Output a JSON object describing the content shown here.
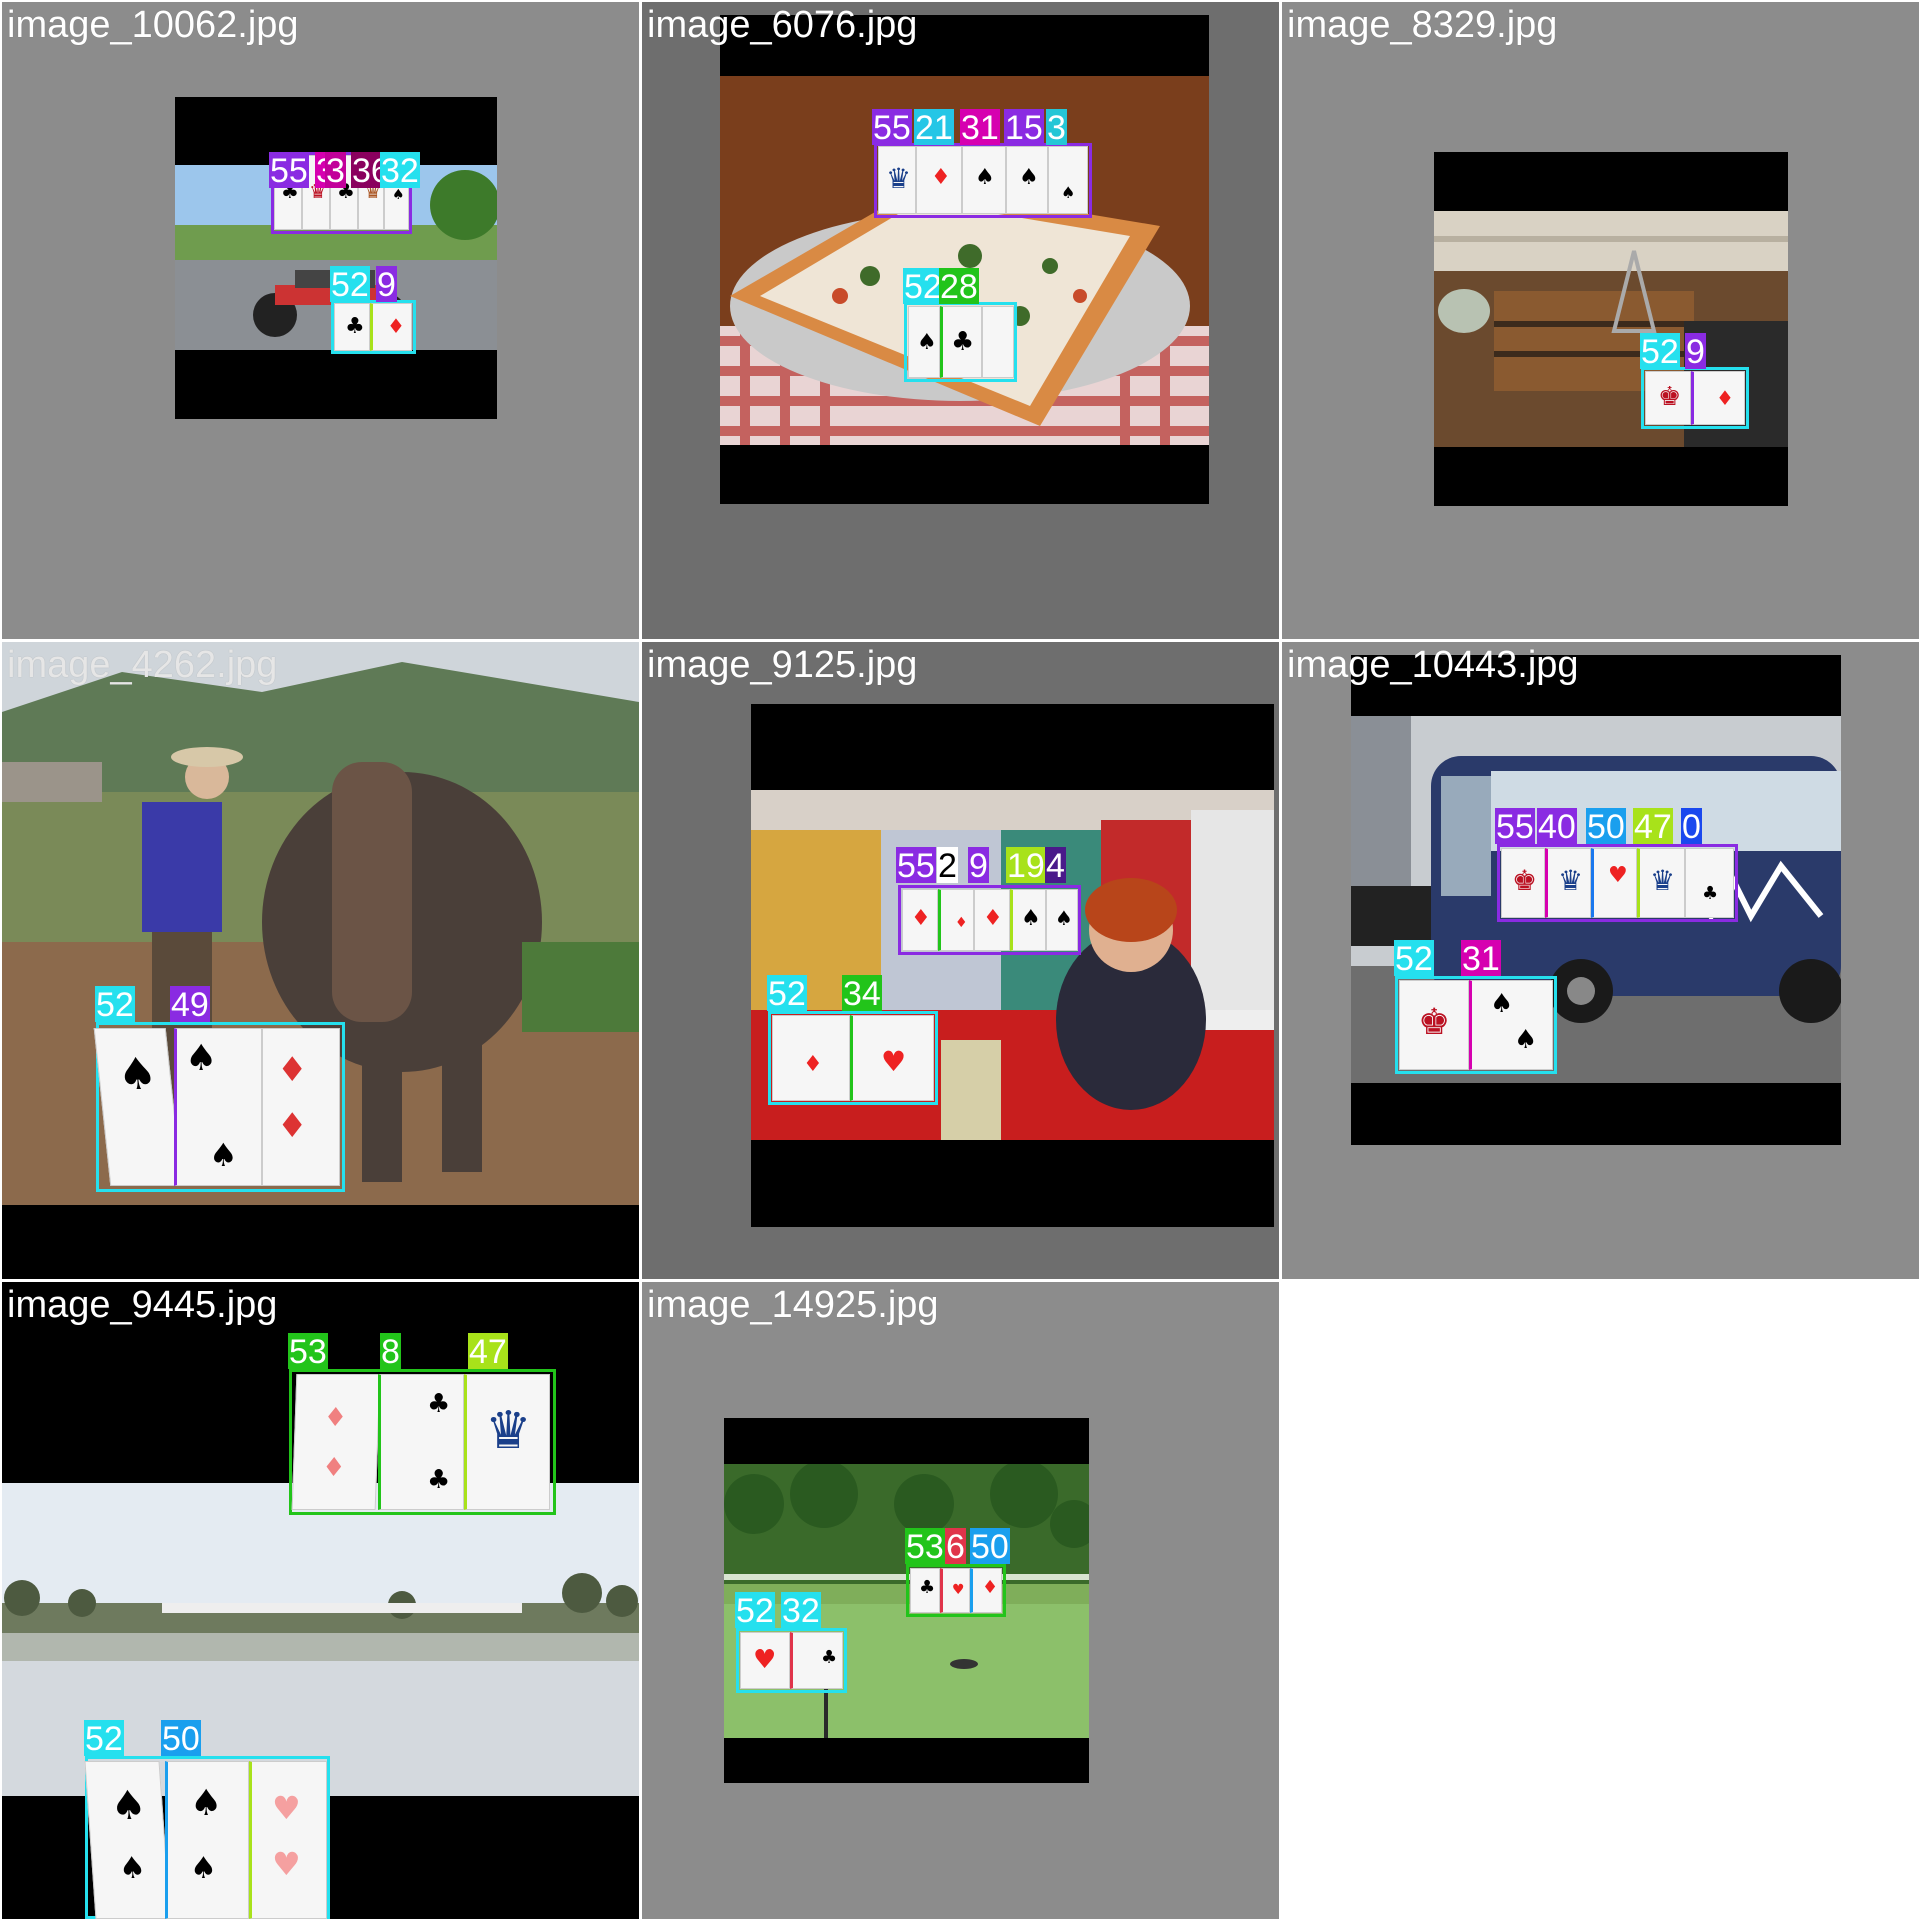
{
  "tiles": [
    {
      "file": "image_10062.jpg",
      "labels": [
        "55",
        "3",
        "3",
        "36",
        "32",
        "52",
        "9"
      ]
    },
    {
      "file": "image_6076.jpg",
      "labels": [
        "55",
        "21",
        "31",
        "15",
        "3",
        "52",
        "28"
      ]
    },
    {
      "file": "image_8329.jpg",
      "labels": [
        "52",
        "9"
      ]
    },
    {
      "file": "image_4262.jpg",
      "labels": [
        "52",
        "49"
      ]
    },
    {
      "file": "image_9125.jpg",
      "labels": [
        "55",
        "2",
        "9",
        "19",
        "4",
        "52",
        "34"
      ]
    },
    {
      "file": "image_10443.jpg",
      "labels": [
        "55",
        "40",
        "50",
        "47",
        "0",
        "52",
        "31"
      ]
    },
    {
      "file": "image_9445.jpg",
      "labels": [
        "53",
        "8",
        "47",
        "52",
        "50"
      ]
    },
    {
      "file": "image_14925.jpg",
      "labels": [
        "53",
        "6",
        "50",
        "52",
        "32"
      ]
    }
  ],
  "colors": {
    "grey_bg": "#8c8c8c",
    "dark_grey_bg": "#6e6e6e",
    "cyan": "#25e0ee",
    "purple": "#8a2be2",
    "magenta": "#d600b0",
    "green": "#22c41a",
    "lime": "#a8e21a",
    "blue": "#1a78ee"
  }
}
